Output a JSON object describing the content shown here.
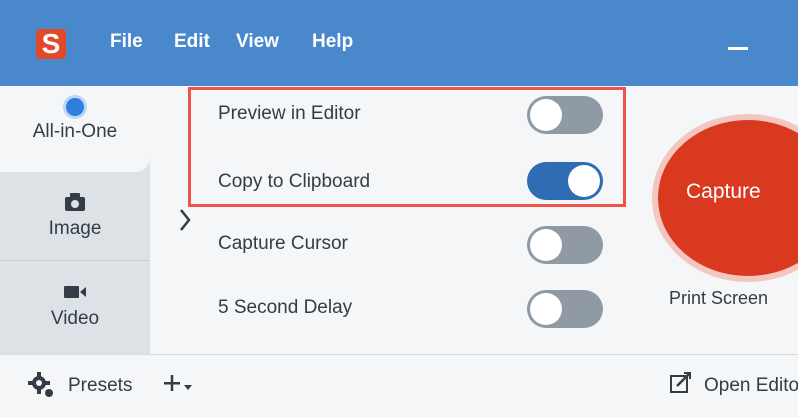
{
  "app": {
    "logo_letter": "S",
    "menu": {
      "file": "File",
      "edit": "Edit",
      "view": "View",
      "help": "Help"
    }
  },
  "tabs": {
    "all_in_one": "All-in-One",
    "image": "Image",
    "video": "Video"
  },
  "options": [
    {
      "label": "Preview in Editor",
      "enabled": false
    },
    {
      "label": "Copy to Clipboard",
      "enabled": true
    },
    {
      "label": "Capture Cursor",
      "enabled": false
    },
    {
      "label": "5 Second Delay",
      "enabled": false
    }
  ],
  "capture": {
    "button_label": "Capture",
    "shortcut_label": "Print Screen"
  },
  "bottom": {
    "presets_label": "Presets",
    "open_editor_label": "Open Editor"
  },
  "colors": {
    "titlebar": "#4a88cc",
    "capture_red": "#d9391f",
    "toggle_on": "#2e6db3",
    "toggle_off": "#8f9aa5",
    "highlight": "#f0524a"
  }
}
